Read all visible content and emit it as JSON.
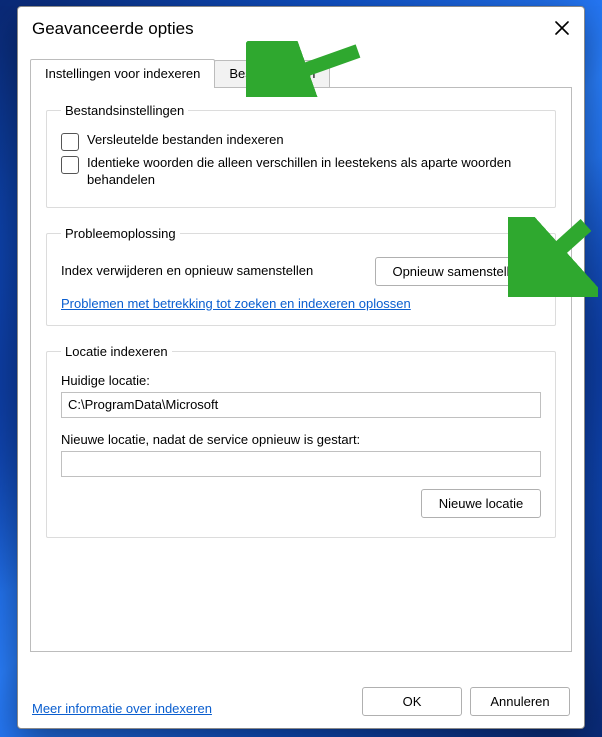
{
  "title": "Geavanceerde opties",
  "tabs": {
    "indexing": "Instellingen voor indexeren",
    "filetypes": "Bestandstypen"
  },
  "file_settings": {
    "legend": "Bestandsinstellingen",
    "encrypt": "Versleutelde bestanden indexeren",
    "diacritics": "Identieke woorden die alleen verschillen in leestekens als aparte woorden behandelen"
  },
  "troubleshoot": {
    "legend": "Probleemoplossing",
    "rebuild_text": "Index verwijderen en opnieuw samenstellen",
    "rebuild_btn": "Opnieuw samenstellen",
    "link": "Problemen met betrekking tot zoeken en indexeren oplossen"
  },
  "index_loc": {
    "legend": "Locatie indexeren",
    "current_label": "Huidige locatie:",
    "current_value": "C:\\ProgramData\\Microsoft",
    "new_label": "Nieuwe locatie, nadat de service opnieuw is gestart:",
    "new_value": "",
    "new_btn": "Nieuwe locatie"
  },
  "footer_link": "Meer informatie over indexeren",
  "buttons": {
    "ok": "OK",
    "cancel": "Annuleren"
  },
  "colors": {
    "arrow": "#2fa82f"
  }
}
